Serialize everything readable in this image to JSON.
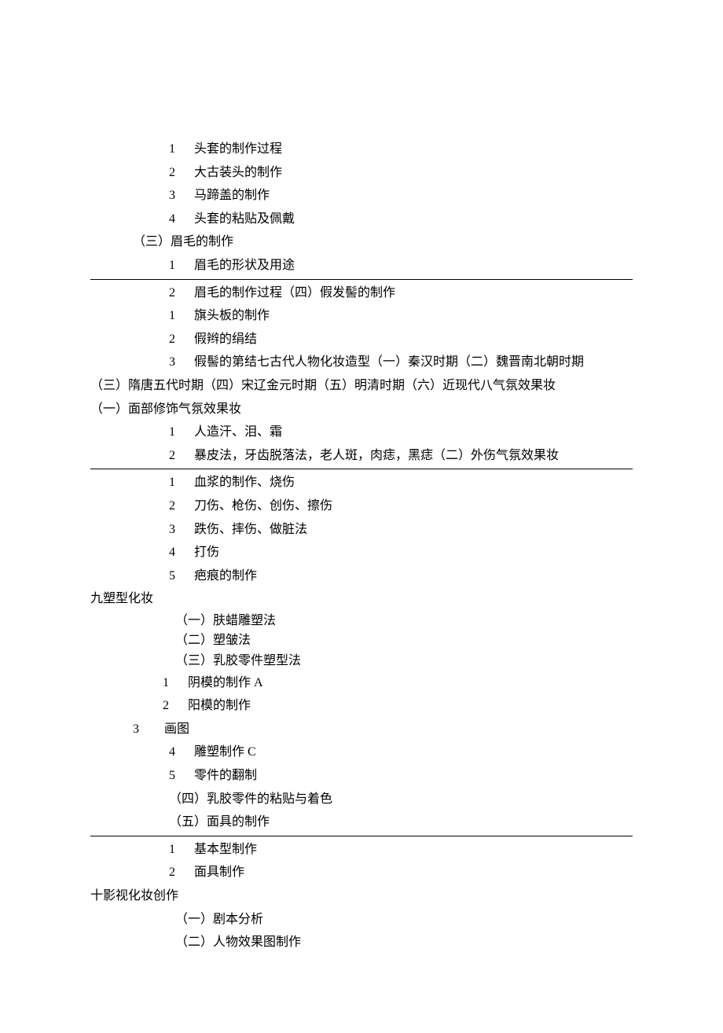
{
  "items": {
    "l1": {
      "n": "1",
      "t": "头套的制作过程"
    },
    "l2": {
      "n": "2",
      "t": "大古装头的制作"
    },
    "l3": {
      "n": "3",
      "t": "马蹄盖的制作"
    },
    "l4": {
      "n": "4",
      "t": "头套的粘贴及佩戴"
    },
    "l5": "（三）眉毛的制作",
    "l6": {
      "n": "1",
      "t": "眉毛的形状及用途"
    },
    "l7": {
      "n": "2",
      "t": "眉毛的制作过程（四）假发髻的制作"
    },
    "l8": {
      "n": "1",
      "t": "旗头板的制作"
    },
    "l9": {
      "n": "2",
      "t": "假辫的绢结"
    },
    "l10": {
      "n": "3",
      "t": "假髻的第结七古代人物化妆造型（一）秦汉时期（二）魏晋南北朝时期"
    },
    "l11": "（三）隋唐五代时期（四）宋辽金元时期（五）明清时期（六）近现代八气氛效果妆",
    "l12": "（一）面部修饰气氛效果妆",
    "l13": {
      "n": "1",
      "t": "人造汗、泪、霜"
    },
    "l14": {
      "n": "2",
      "t": "暴皮法，牙齿脱落法，老人斑，肉痣，黑痣（二）外伤气氛效果妆"
    },
    "l15": {
      "n": "1",
      "t": "血浆的制作、烧伤"
    },
    "l16": {
      "n": "2",
      "t": "刀伤、枪伤、创伤、擦伤"
    },
    "l17": {
      "n": "3",
      "t": "跌伤、摔伤、做脏法"
    },
    "l18": {
      "n": "4",
      "t": "打伤"
    },
    "l19": {
      "n": "5",
      "t": "疤痕的制作"
    },
    "l20": "九塑型化妆",
    "l21": "（一）肤蜡雕塑法",
    "l22": "（二）塑皱法",
    "l23": "（三）乳胶零件塑型法",
    "l24": {
      "n": "1",
      "t": "阴模的制作 A"
    },
    "l25": {
      "n": "2",
      "t": "阳模的制作"
    },
    "l26": {
      "n": "3",
      "t": "画图"
    },
    "l27": {
      "n": "4",
      "t": "雕塑制作 C"
    },
    "l28": {
      "n": "5",
      "t": "零件的翻制"
    },
    "l29": "（四）乳胶零件的粘贴与着色",
    "l30": "（五）面具的制作",
    "l31": {
      "n": "1",
      "t": "基本型制作"
    },
    "l32": {
      "n": "2",
      "t": "面具制作"
    },
    "l33": "十影视化妆创作",
    "l34": "（一）剧本分析",
    "l35": "（二）人物效果图制作"
  }
}
